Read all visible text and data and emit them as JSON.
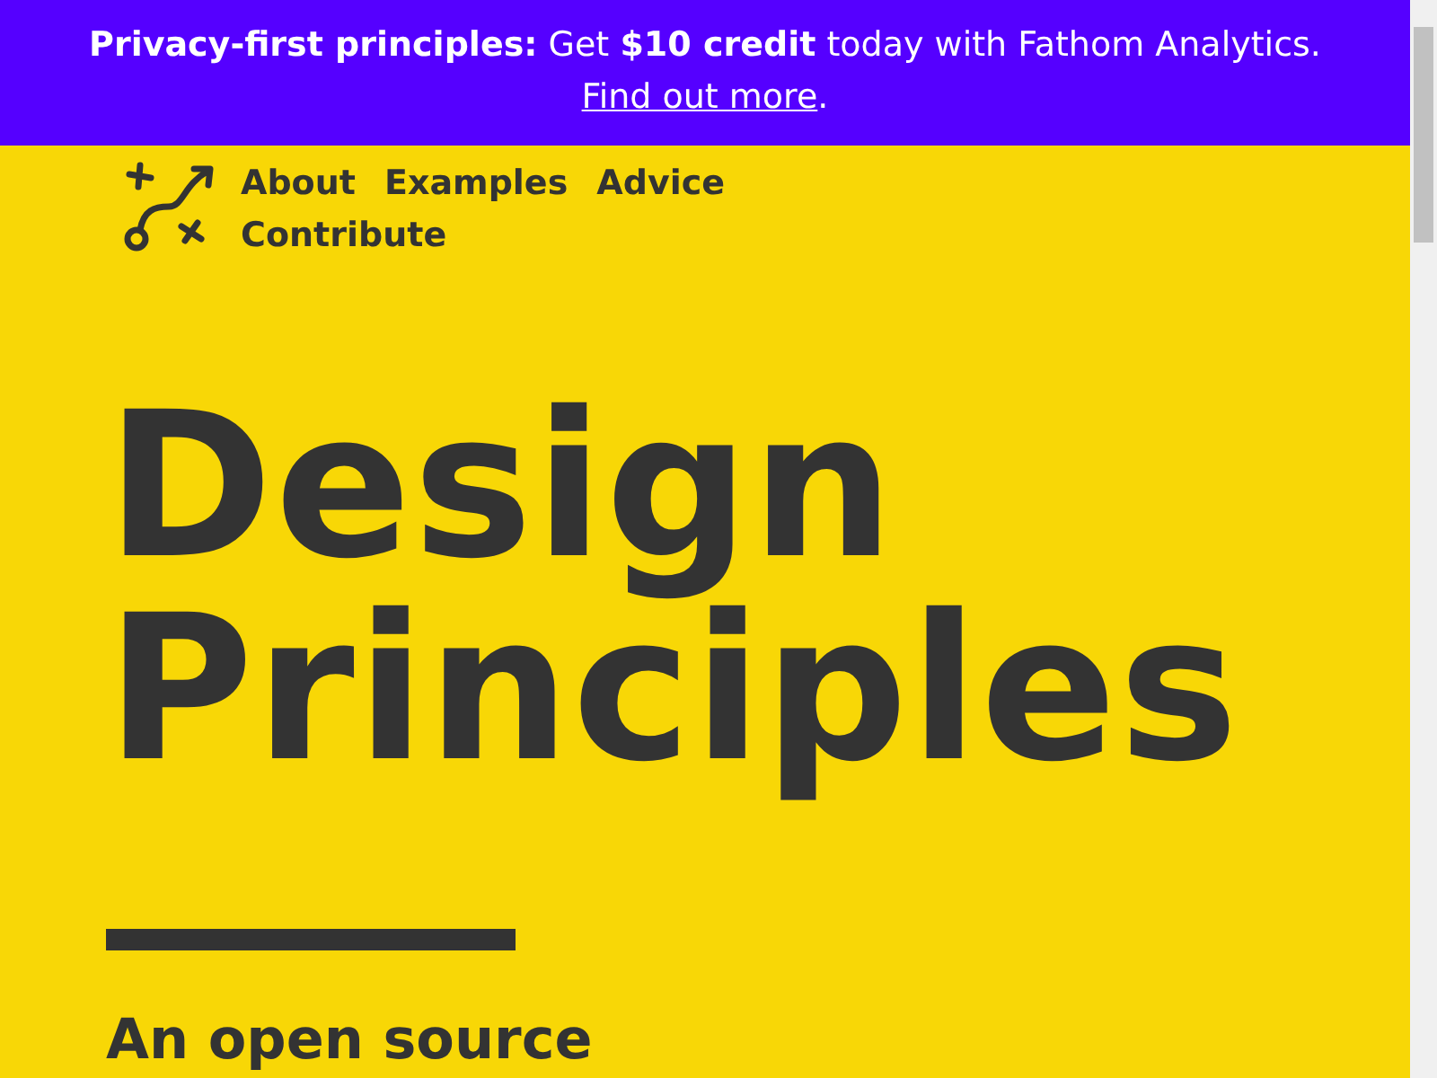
{
  "banner": {
    "text": "**Privacy-first principles:** Get **$10 credit** today with Fathom Analytics.",
    "link": "Find out more",
    "after_link": "."
  },
  "nav": {
    "links": [
      {
        "label": "About"
      },
      {
        "label": "Examples"
      },
      {
        "label": "Advice"
      },
      {
        "label": "Contribute"
      }
    ]
  },
  "hero": {
    "title_lines": [
      "Design",
      "Principles"
    ],
    "subtitle": "An open source"
  }
}
